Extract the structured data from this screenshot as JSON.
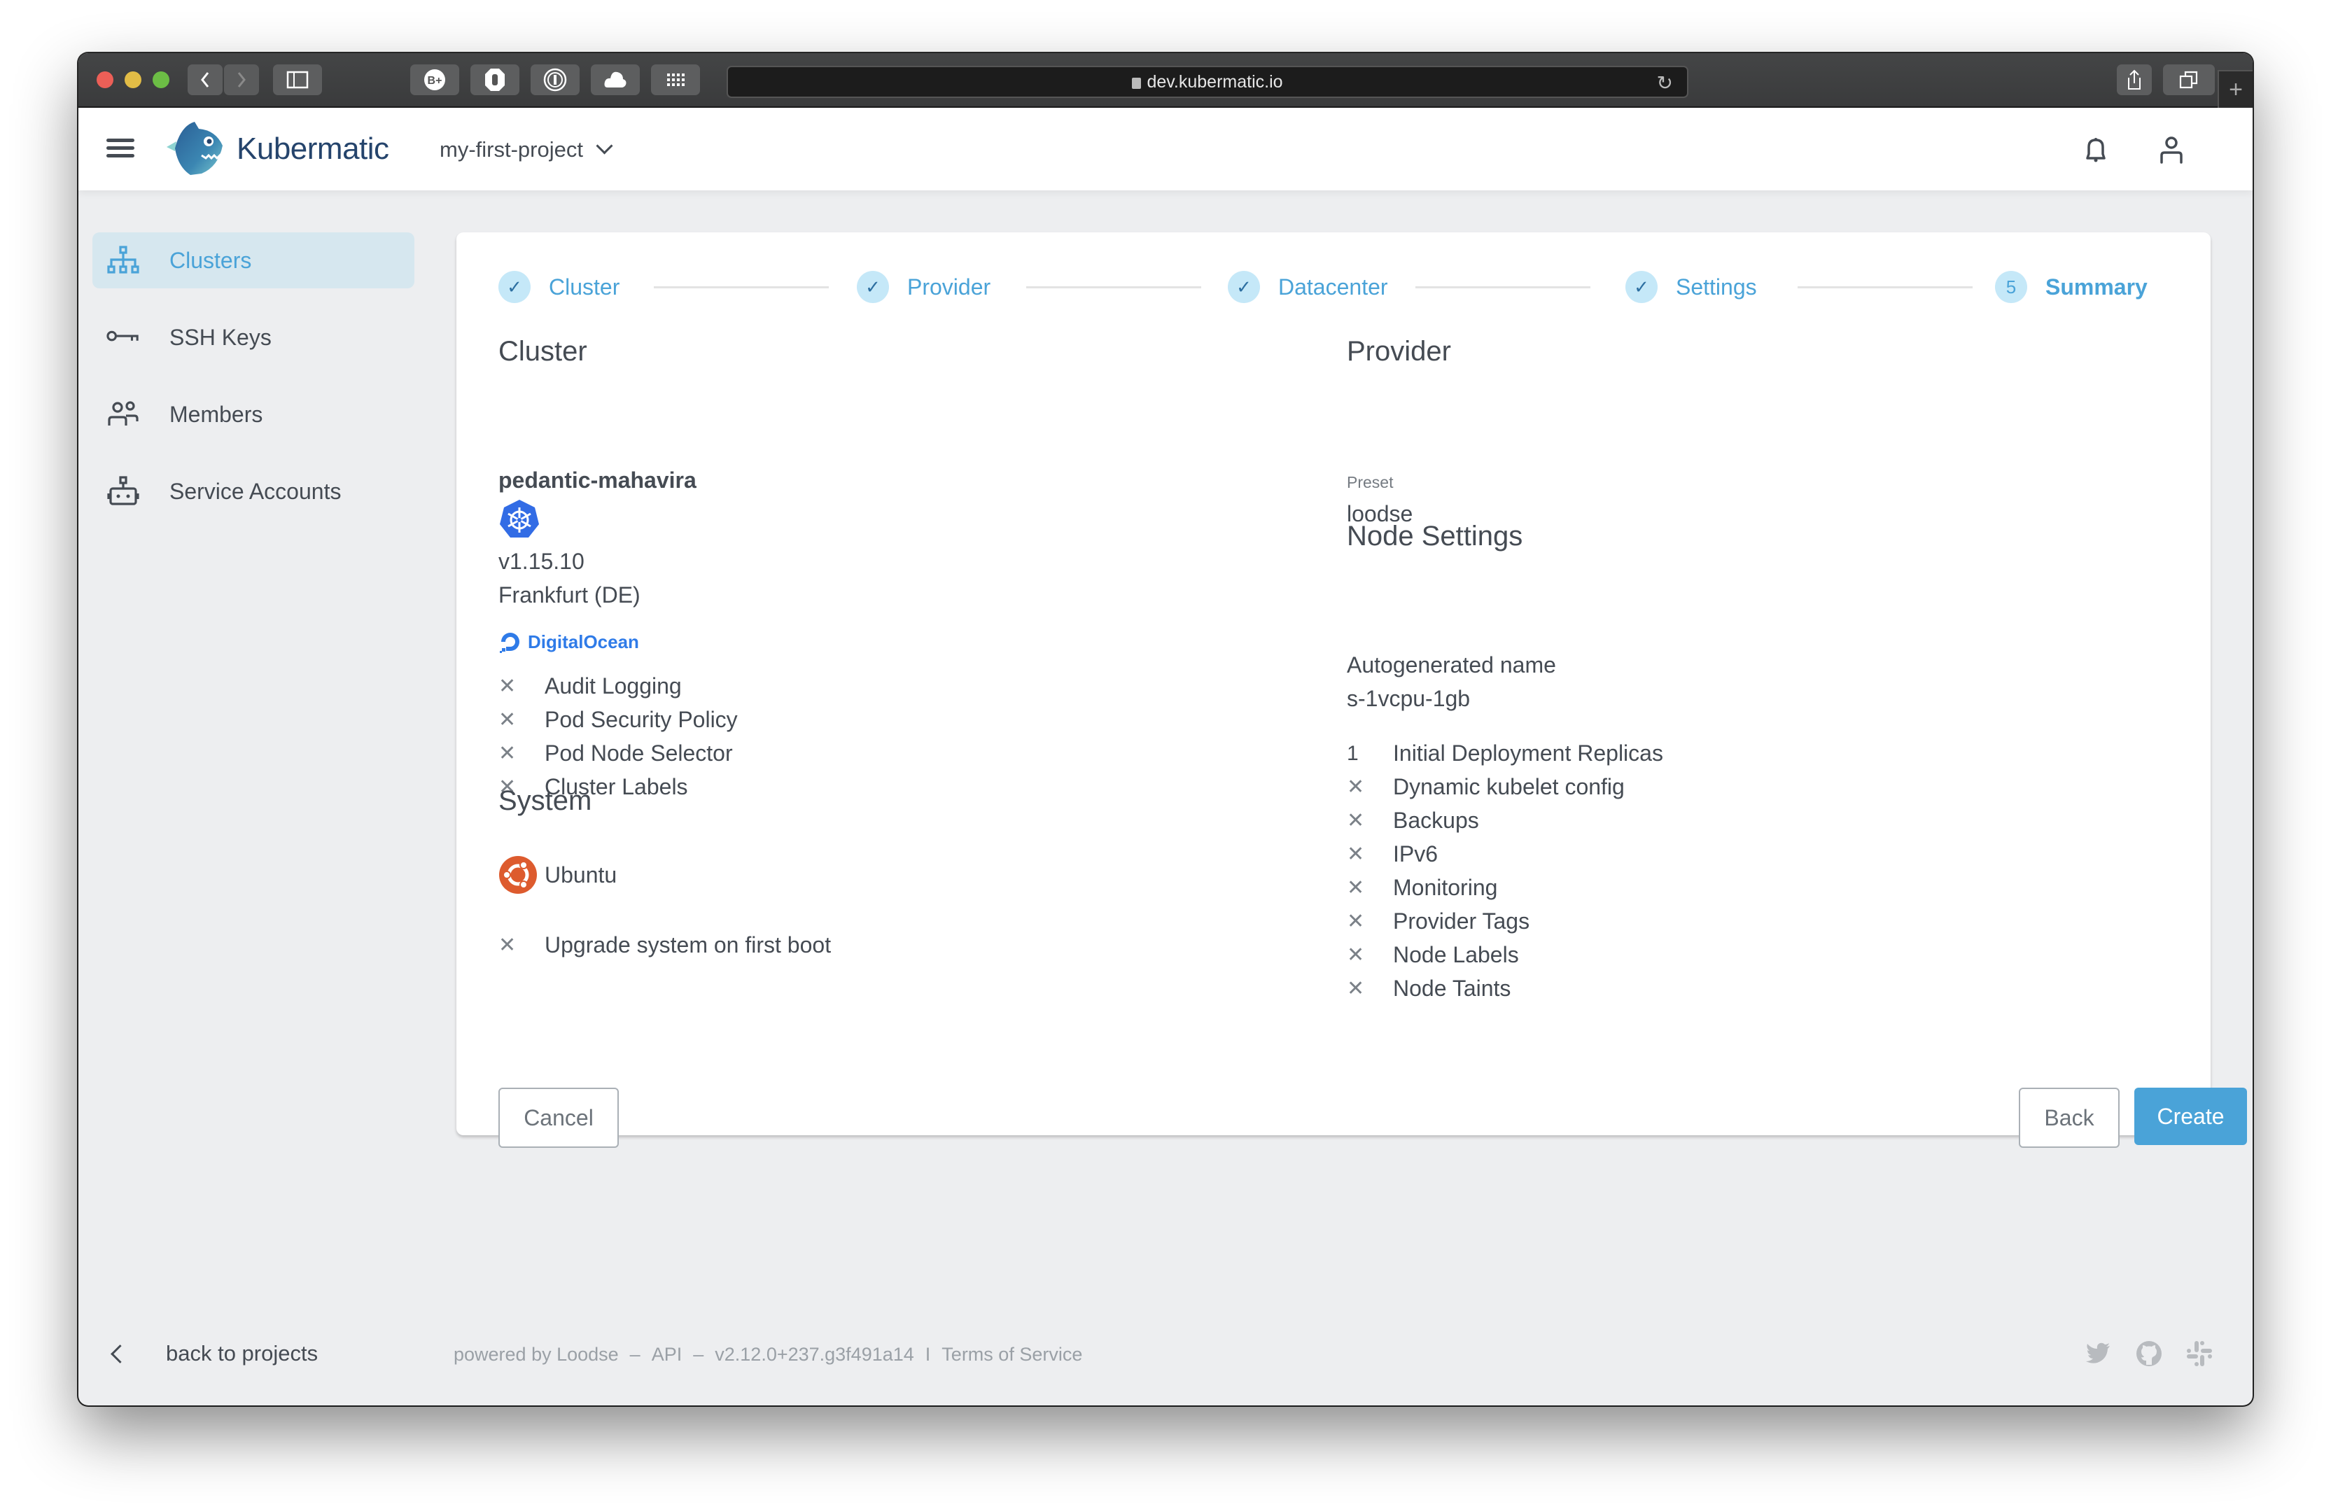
{
  "browser": {
    "url": "dev.kubermatic.io",
    "toolbar_icons": [
      "back-icon",
      "forward-icon",
      "sidebar-icon",
      "extension-bplus-icon",
      "adblock-icon",
      "onepassword-icon",
      "cloud-icon",
      "grid-icon",
      "reload-icon",
      "share-icon",
      "tabs-icon",
      "new-tab-icon"
    ]
  },
  "header": {
    "brand": "Kubermatic",
    "project": "my-first-project"
  },
  "sidebar": {
    "items": [
      {
        "label": "Clusters",
        "icon": "sitemap-icon",
        "active": true
      },
      {
        "label": "SSH Keys",
        "icon": "key-icon",
        "active": false
      },
      {
        "label": "Members",
        "icon": "members-icon",
        "active": false
      },
      {
        "label": "Service Accounts",
        "icon": "robot-icon",
        "active": false
      }
    ],
    "back_label": "back to projects"
  },
  "stepper": {
    "steps": [
      {
        "label": "Cluster",
        "state": "done"
      },
      {
        "label": "Provider",
        "state": "done"
      },
      {
        "label": "Datacenter",
        "state": "done"
      },
      {
        "label": "Settings",
        "state": "done"
      },
      {
        "label": "Summary",
        "state": "active",
        "number": "5"
      }
    ]
  },
  "summary": {
    "cluster": {
      "title": "Cluster",
      "name": "pedantic-mahavira",
      "version": "v1.15.10",
      "location": "Frankfurt (DE)",
      "provider_logo_text": "DigitalOcean",
      "features": [
        {
          "mark": "✕",
          "label": "Audit Logging"
        },
        {
          "mark": "✕",
          "label": "Pod Security Policy"
        },
        {
          "mark": "✕",
          "label": "Pod Node Selector"
        },
        {
          "mark": "✕",
          "label": "Cluster Labels"
        }
      ]
    },
    "system": {
      "title": "System",
      "os": "Ubuntu",
      "options": [
        {
          "mark": "✕",
          "label": "Upgrade system on first boot"
        }
      ]
    },
    "provider": {
      "title": "Provider",
      "preset_label": "Preset",
      "preset_value": "loodse"
    },
    "node_settings": {
      "title": "Node Settings",
      "name_label": "Autogenerated name",
      "size": "s-1vcpu-1gb",
      "items": [
        {
          "mark": "1",
          "label": "Initial Deployment Replicas"
        },
        {
          "mark": "✕",
          "label": "Dynamic kubelet config"
        },
        {
          "mark": "✕",
          "label": "Backups"
        },
        {
          "mark": "✕",
          "label": "IPv6"
        },
        {
          "mark": "✕",
          "label": "Monitoring"
        },
        {
          "mark": "✕",
          "label": "Provider Tags"
        },
        {
          "mark": "✕",
          "label": "Node Labels"
        },
        {
          "mark": "✕",
          "label": "Node Taints"
        }
      ]
    }
  },
  "actions": {
    "cancel": "Cancel",
    "back": "Back",
    "create": "Create"
  },
  "footer": {
    "powered_by": "powered by Loodse",
    "sep1": "–",
    "api": "API",
    "sep2": "–",
    "version": "v2.12.0+237.g3f491a14",
    "sep3": "I",
    "terms": "Terms of Service",
    "social": [
      "twitter-icon",
      "github-icon",
      "slack-icon"
    ]
  },
  "colors": {
    "accent": "#4aa3d8",
    "step_circle": "#c5e8f8",
    "sidebar_active_bg": "#d6e7ef",
    "brand": "#25446c",
    "text": "#454b53",
    "ubuntu": "#dd5b2e",
    "kubernetes": "#326ce5",
    "digitalocean": "#2f7be8"
  }
}
